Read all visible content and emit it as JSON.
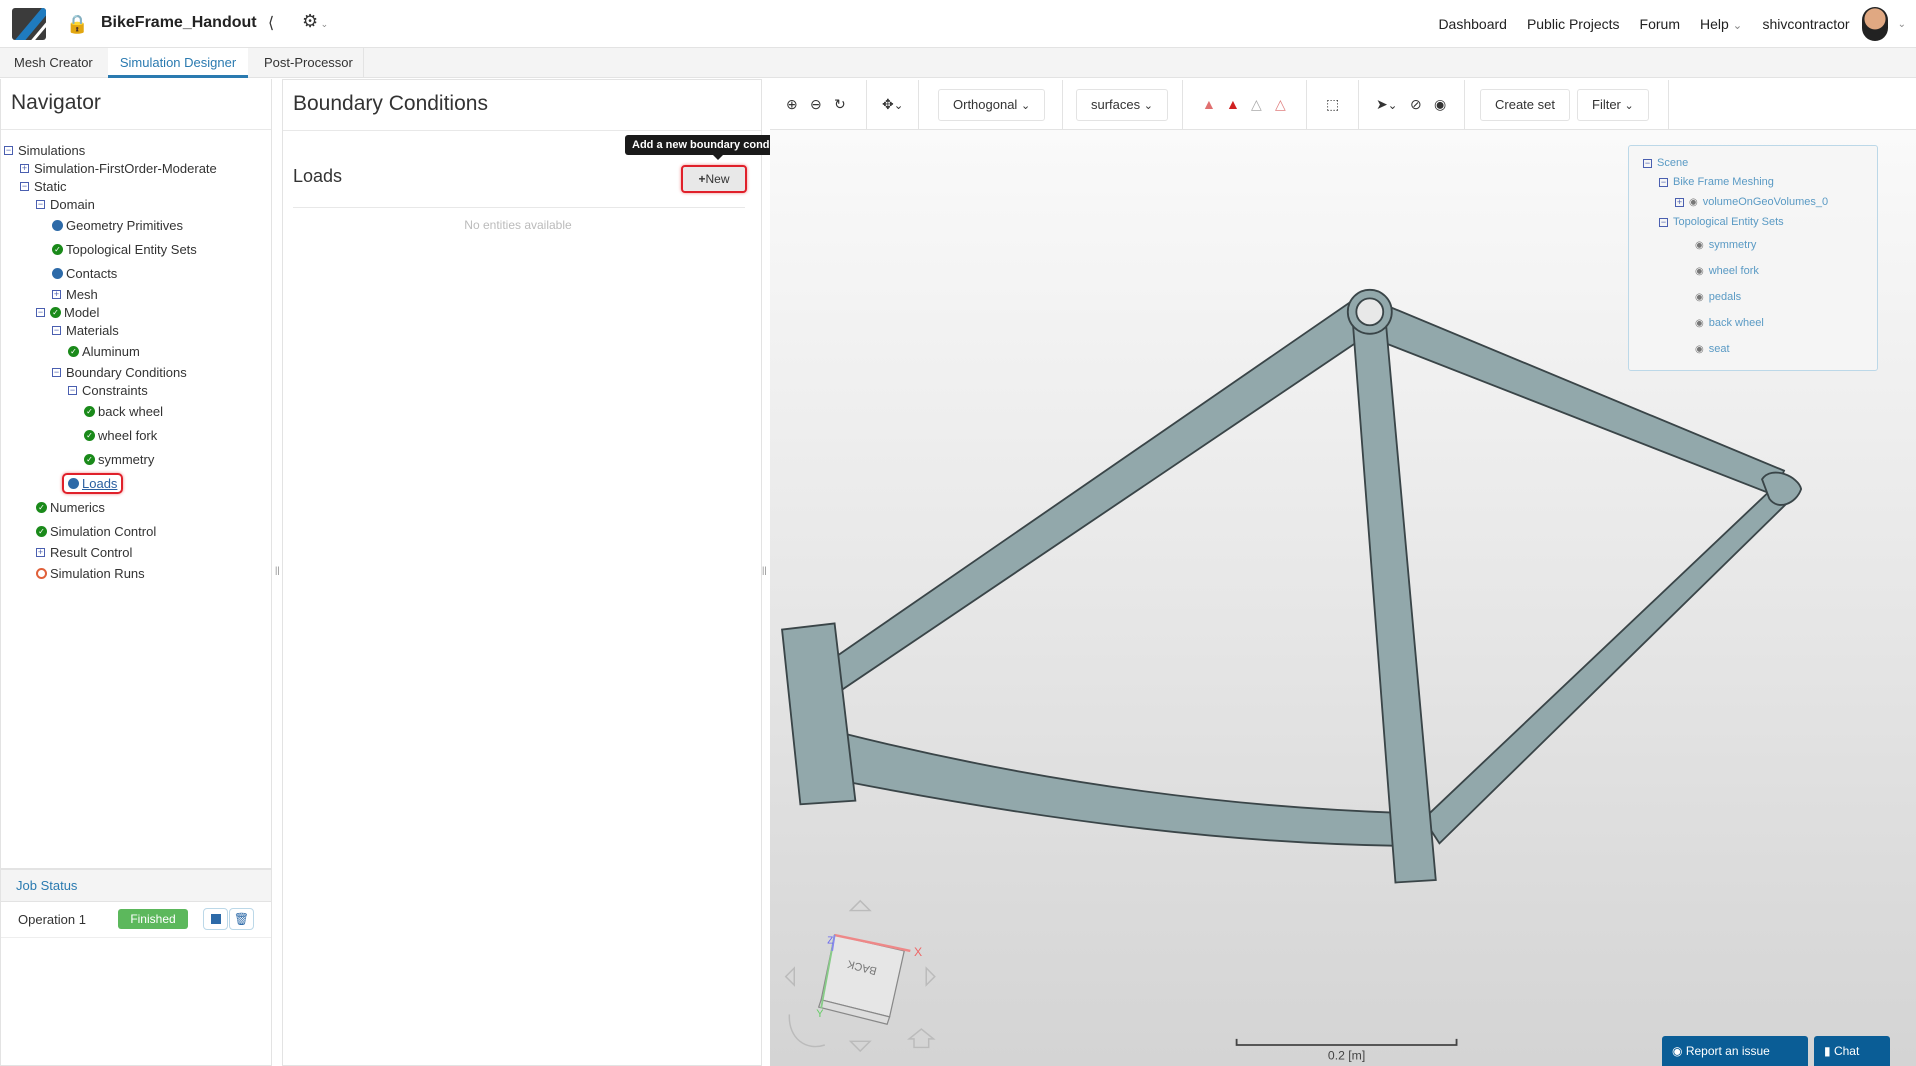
{
  "header": {
    "project_title": "BikeFrame_Handout",
    "nav": [
      "Dashboard",
      "Public Projects",
      "Forum",
      "Help"
    ],
    "user": "shivcontractor"
  },
  "workflow_tabs": [
    {
      "label": "Mesh Creator"
    },
    {
      "label": "Simulation Designer",
      "active": true
    },
    {
      "label": "Post-Processor"
    }
  ],
  "navigator": {
    "title": "Navigator",
    "tree": [
      {
        "label": "Simulations",
        "toggle": "minus"
      },
      {
        "label": "Simulation-FirstOrder-Moderate",
        "toggle": "plus"
      },
      {
        "label": "Static",
        "toggle": "minus"
      },
      {
        "label": "Domain",
        "toggle": "minus"
      },
      {
        "label": "Geometry Primitives",
        "status": "dot"
      },
      {
        "label": "Topological Entity Sets",
        "status": "check"
      },
      {
        "label": "Contacts",
        "status": "dot"
      },
      {
        "label": "Mesh",
        "toggle": "plus"
      },
      {
        "label": "Model",
        "toggle": "minus",
        "status": "check"
      },
      {
        "label": "Materials",
        "toggle": "minus"
      },
      {
        "label": "Aluminum",
        "status": "check"
      },
      {
        "label": "Boundary Conditions",
        "toggle": "minus"
      },
      {
        "label": "Constraints",
        "toggle": "minus"
      },
      {
        "label": "back wheel",
        "status": "check"
      },
      {
        "label": "wheel fork",
        "status": "check"
      },
      {
        "label": "symmetry",
        "status": "check"
      },
      {
        "label": "Loads",
        "status": "dot",
        "selected": true
      },
      {
        "label": "Numerics",
        "status": "check"
      },
      {
        "label": "Simulation Control",
        "status": "check"
      },
      {
        "label": "Result Control",
        "toggle": "plus"
      },
      {
        "label": "Simulation Runs",
        "status": "ring"
      }
    ]
  },
  "job_status": {
    "title": "Job Status",
    "operation": "Operation 1",
    "status": "Finished",
    "status_color": "#5cb85c"
  },
  "bc_panel": {
    "title": "Boundary Conditions",
    "section": "Loads",
    "new_button": "New",
    "tooltip": "Add a new boundary condition here",
    "empty_text": "No entities available"
  },
  "toolbar": {
    "projection": "Orthogonal",
    "render_mode": "surfaces",
    "create_set": "Create set",
    "filter": "Filter"
  },
  "scene_tree": {
    "items": [
      "Scene",
      "Bike Frame Meshing",
      "volumeOnGeoVolumes_0",
      "Topological Entity Sets",
      "symmetry",
      "wheel fork",
      "pedals",
      "back wheel",
      "seat"
    ]
  },
  "viewport": {
    "scale_label": "0.2 [m]",
    "cube_face": "BACK",
    "axes": [
      "X",
      "Y",
      "Z"
    ]
  },
  "footer": {
    "report": "Report an issue",
    "chat": "Chat"
  }
}
